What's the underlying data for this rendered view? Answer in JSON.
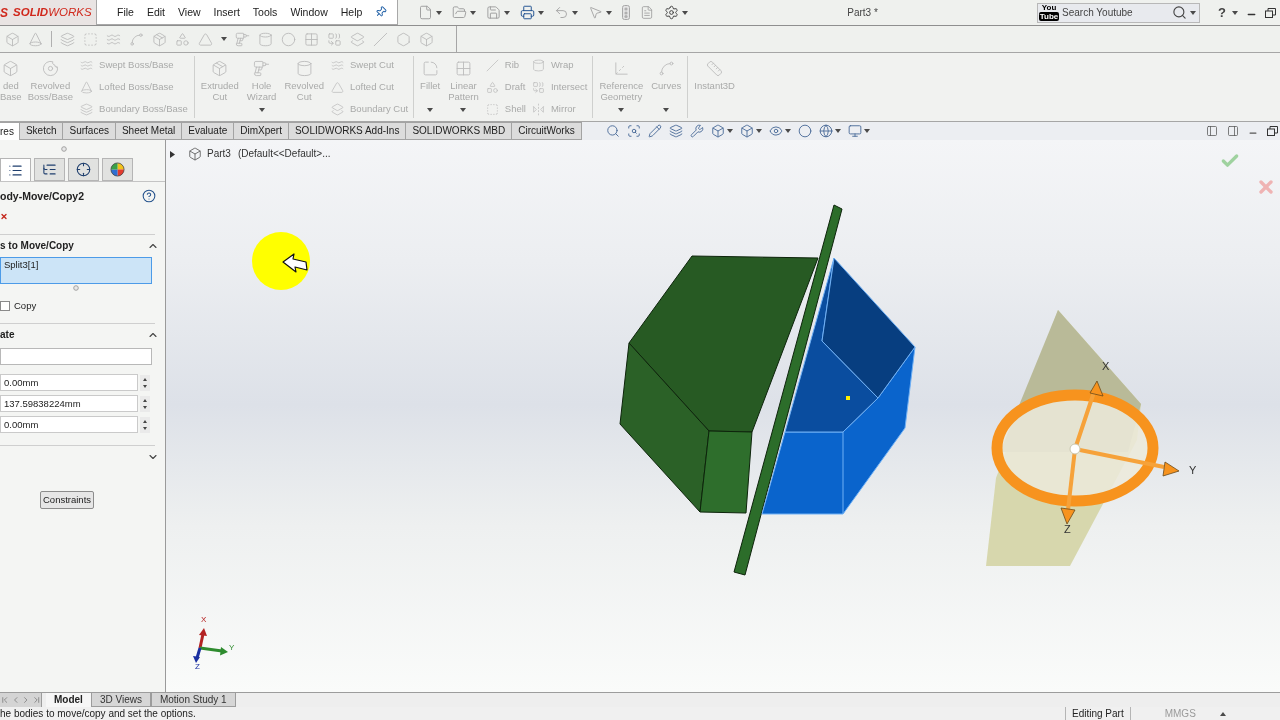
{
  "title_bar": {
    "logo_mark": "S",
    "logo": "**SOLID**WORKS",
    "menu": [
      "File",
      "Edit",
      "View",
      "Insert",
      "Tools",
      "Window",
      "Help"
    ],
    "document_title": "Part3 *",
    "search": {
      "logo": [
        "You",
        "Tube"
      ],
      "placeholder": "Search Youtube"
    },
    "help": "?"
  },
  "command_manager": {
    "groups": [
      {
        "items": [
          {
            "kind": "large",
            "lines": [
              "ded",
              "Base"
            ],
            "disabled": true
          },
          {
            "kind": "large",
            "lines": [
              "Revolved",
              "Boss/Base"
            ],
            "disabled": true
          },
          {
            "kind": "stack",
            "entries": [
              {
                "label": "Swept Boss/Base",
                "disabled": true
              },
              {
                "label": "Lofted Boss/Base",
                "disabled": true
              },
              {
                "label": "Boundary Boss/Base",
                "disabled": true
              }
            ]
          }
        ]
      },
      {
        "items": [
          {
            "kind": "large",
            "lines": [
              "Extruded",
              "Cut"
            ],
            "disabled": true
          },
          {
            "kind": "dropdown",
            "lines": [
              "Hole",
              "Wizard"
            ],
            "disabled": true
          },
          {
            "kind": "large",
            "lines": [
              "Revolved",
              "Cut"
            ],
            "disabled": true
          },
          {
            "kind": "stack",
            "entries": [
              {
                "label": "Swept Cut",
                "disabled": true
              },
              {
                "label": "Lofted Cut",
                "disabled": true
              },
              {
                "label": "Boundary Cut",
                "disabled": true
              }
            ]
          }
        ]
      },
      {
        "items": [
          {
            "kind": "dropdown",
            "lines": [
              "Fillet"
            ],
            "disabled": true
          },
          {
            "kind": "dropdown",
            "lines": [
              "Linear",
              "Pattern"
            ],
            "disabled": true
          },
          {
            "kind": "stack",
            "entries": [
              {
                "label": "Rib",
                "disabled": true
              },
              {
                "label": "Draft",
                "disabled": true
              },
              {
                "label": "Shell",
                "disabled": true
              }
            ]
          },
          {
            "kind": "stack",
            "entries": [
              {
                "label": "Wrap",
                "disabled": true
              },
              {
                "label": "Intersect",
                "disabled": true
              },
              {
                "label": "Mirror",
                "disabled": true
              }
            ]
          }
        ]
      },
      {
        "items": [
          {
            "kind": "dropdown",
            "lines": [
              "Reference",
              "Geometry"
            ],
            "disabled": true
          },
          {
            "kind": "dropdown",
            "lines": [
              "Curves"
            ],
            "disabled": true
          }
        ]
      },
      {
        "items": [
          {
            "kind": "large",
            "lines": [
              "Instant3D"
            ],
            "disabled": true
          }
        ]
      }
    ]
  },
  "tabs": [
    {
      "label": "res",
      "selected": true
    },
    {
      "label": "Sketch",
      "selected": false
    },
    {
      "label": "Surfaces",
      "selected": false
    },
    {
      "label": "Sheet Metal",
      "selected": false
    },
    {
      "label": "Evaluate",
      "selected": false
    },
    {
      "label": "DimXpert",
      "selected": false
    },
    {
      "label": "SOLIDWORKS Add-Ins",
      "selected": false
    },
    {
      "label": "SOLIDWORKS MBD",
      "selected": false
    },
    {
      "label": "CircuitWorks",
      "selected": false
    }
  ],
  "property_manager": {
    "panel_tabs": [
      {
        "selected": true
      },
      {
        "selected": false
      },
      {
        "selected": false
      },
      {
        "selected": false
      }
    ],
    "title": "ody-Move/Copy2",
    "sections": [
      {
        "title": "s to Move/Copy",
        "expanded": true,
        "selection": {
          "value": "Split3[1]",
          "active": true
        },
        "options": [
          {
            "label": "Copy",
            "checked": false
          }
        ]
      },
      {
        "title": "ate",
        "expanded": true,
        "fields": [
          {
            "kind": "text"
          },
          {
            "kind": "spin",
            "value": "0.00mm"
          },
          {
            "kind": "spin",
            "value": "137.59838224mm"
          },
          {
            "kind": "spin",
            "value": "0.00mm"
          }
        ]
      },
      {
        "expanded": false
      }
    ],
    "button": "Constraints"
  },
  "viewport": {
    "feature_tree": {
      "root": "Part3",
      "configuration": "(Default<<Default>...",
      "expanded": false
    },
    "triad_labels": [
      "X",
      "Y",
      "Z"
    ],
    "reference_triad_labels": [
      "X",
      "Y",
      "Z"
    ]
  },
  "bottom_tabs": [
    {
      "label": "Model",
      "selected": true
    },
    {
      "label": "3D Views",
      "selected": false
    },
    {
      "label": "Motion Study 1",
      "selected": false
    }
  ],
  "status_bar": {
    "message": "he bodies to move/copy and set the options.",
    "mode": "Editing Part",
    "units": "MMGS"
  }
}
